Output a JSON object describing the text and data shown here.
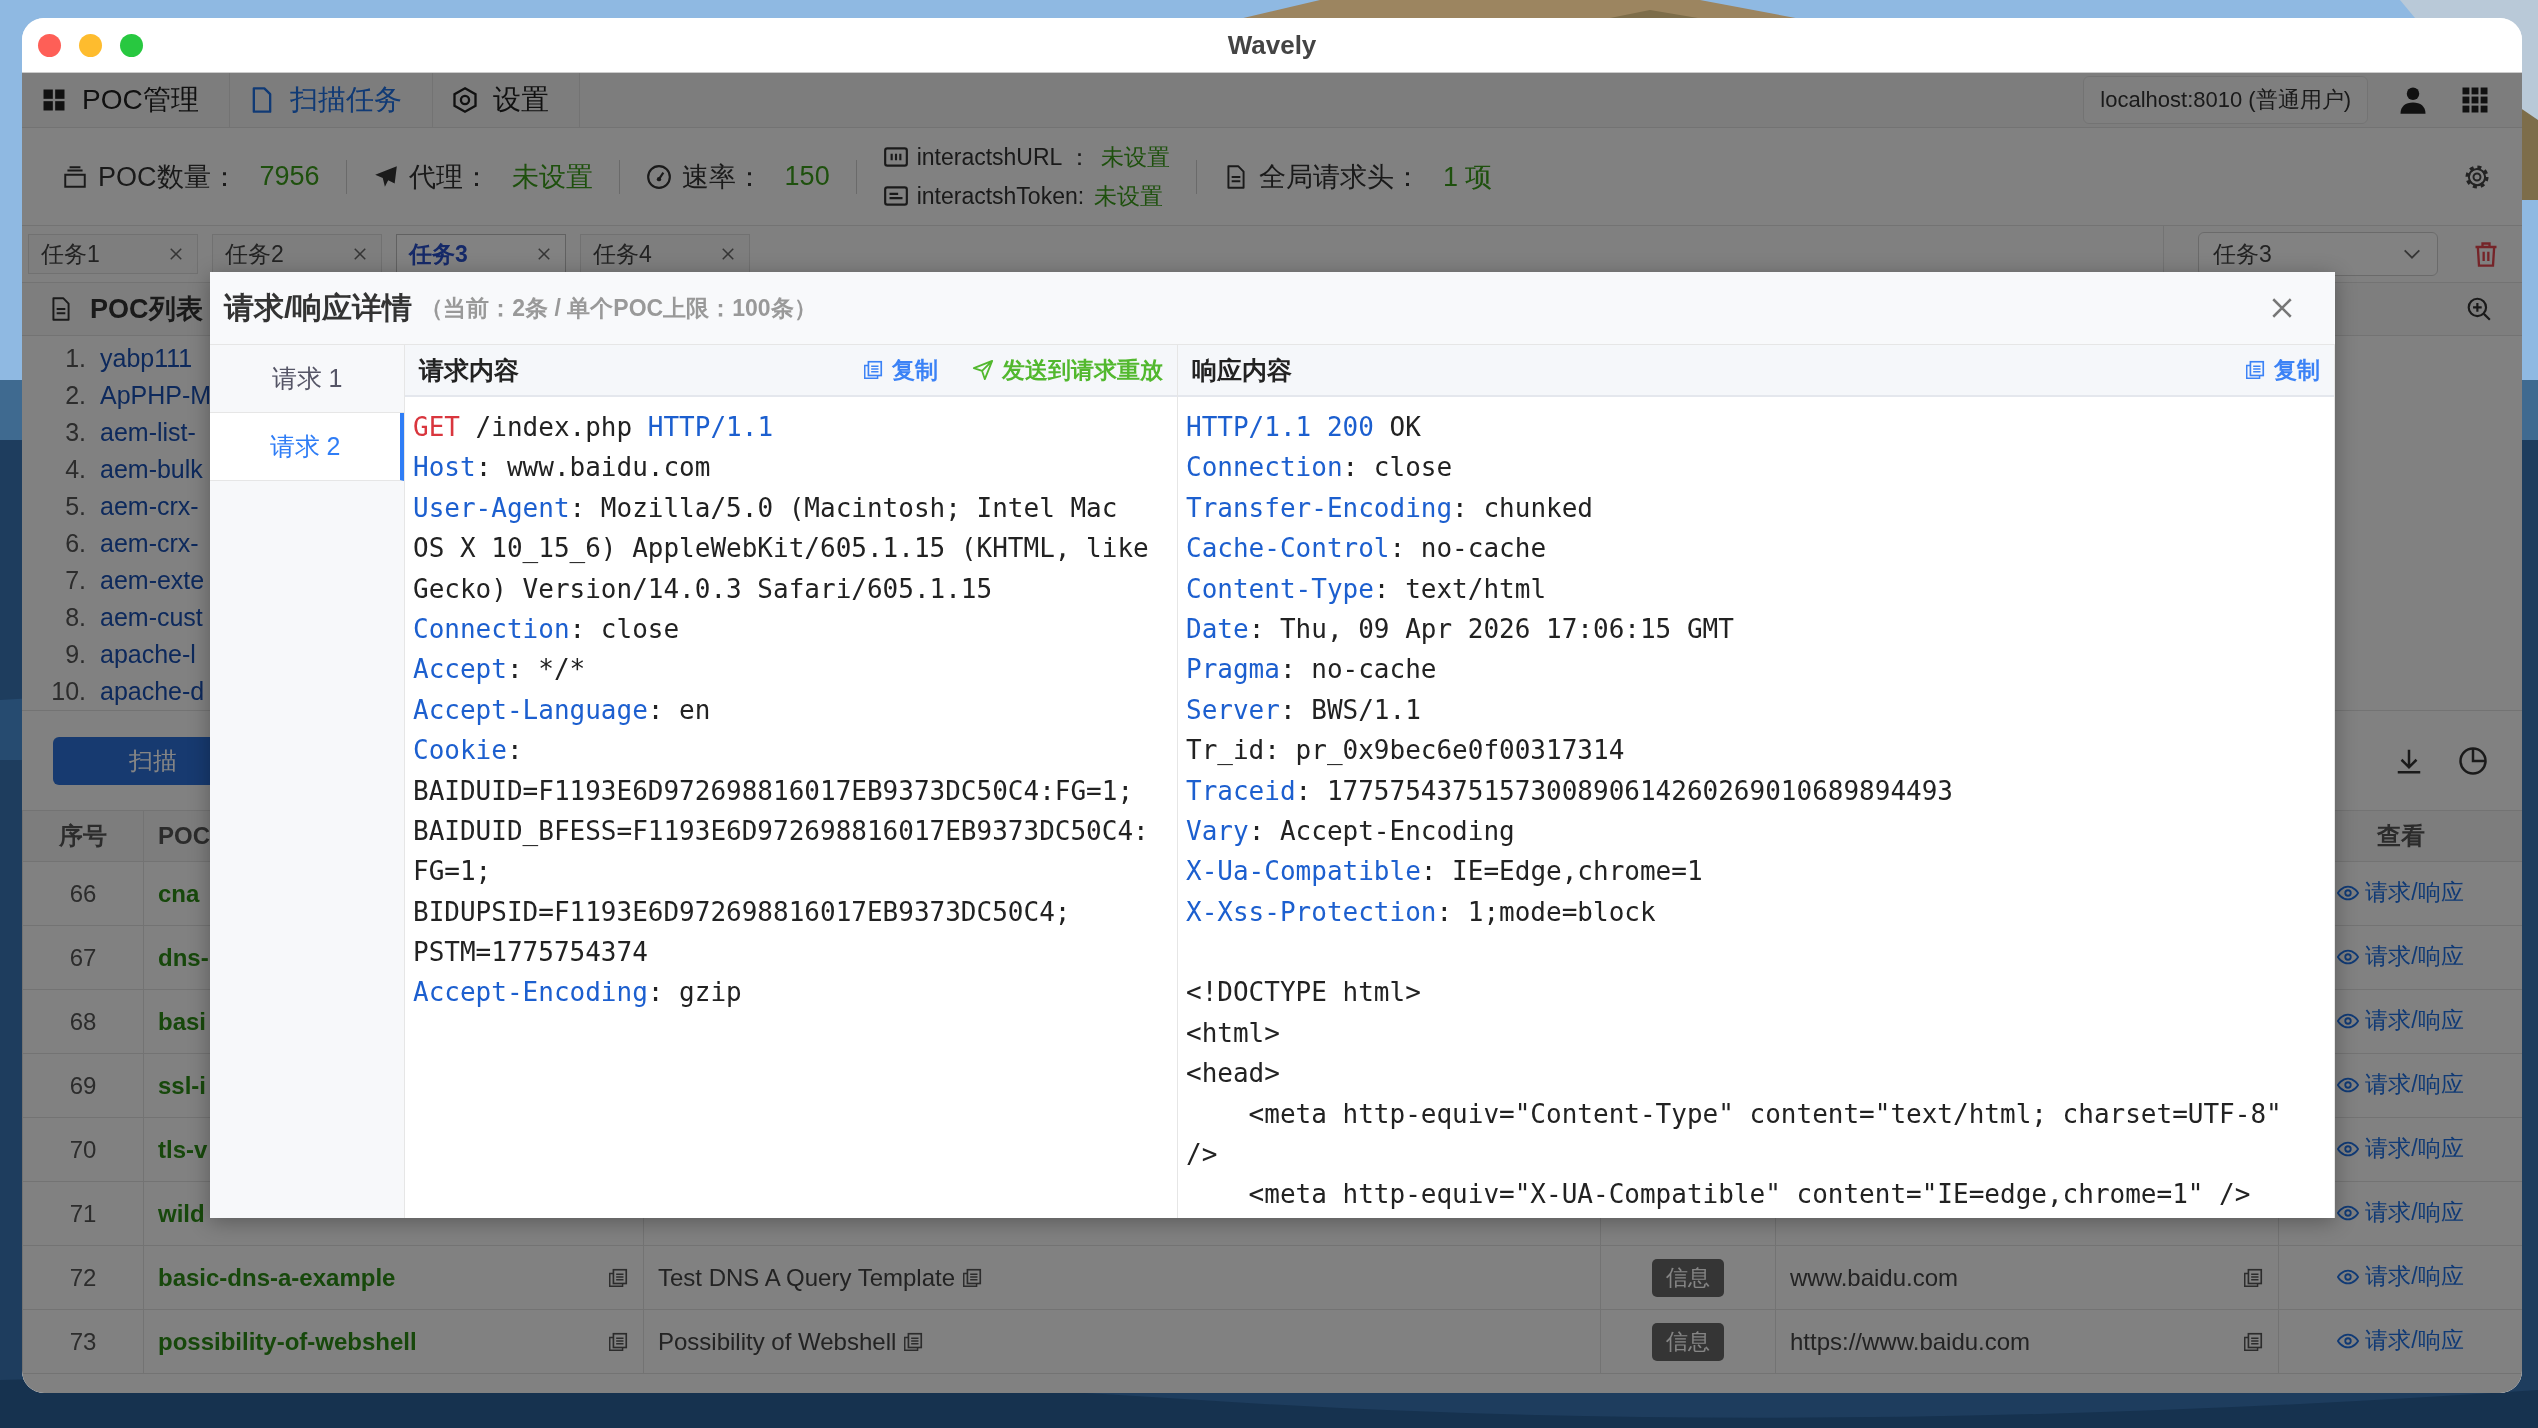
{
  "window": {
    "title": "Wavely"
  },
  "nav": {
    "tabs": [
      {
        "label": "POC管理",
        "selected": false
      },
      {
        "label": "扫描任务",
        "selected": true
      },
      {
        "label": "设置",
        "selected": false
      }
    ],
    "server": "localhost:8010 (普通用户)"
  },
  "stats": [
    {
      "kind": "single",
      "label": "POC数量：",
      "value": "7956"
    },
    {
      "kind": "single",
      "label": "代理：",
      "value": "未设置"
    },
    {
      "kind": "single",
      "label": "速率：",
      "value": "150"
    },
    {
      "kind": "double",
      "items": [
        {
          "label": "interactshURL ：",
          "value": "未设置"
        },
        {
          "label": "interactshToken:",
          "value": "未设置"
        }
      ]
    },
    {
      "kind": "single",
      "label": "全局请求头：",
      "value": "1 项"
    }
  ],
  "task_tabs": [
    {
      "label": "任务1",
      "selected": false
    },
    {
      "label": "任务2",
      "selected": false
    },
    {
      "label": "任务3",
      "selected": true
    },
    {
      "label": "任务4",
      "selected": false
    }
  ],
  "task_select": {
    "value": "任务3"
  },
  "poc_list": {
    "title": "POC列表",
    "items": [
      {
        "number": "1.",
        "name": "yabp111"
      },
      {
        "number": "2.",
        "name": "ApPHP-M"
      },
      {
        "number": "3.",
        "name": "aem-list-"
      },
      {
        "number": "4.",
        "name": "aem-bulk"
      },
      {
        "number": "5.",
        "name": "aem-crx-"
      },
      {
        "number": "6.",
        "name": "aem-crx-"
      },
      {
        "number": "7.",
        "name": "aem-exte"
      },
      {
        "number": "8.",
        "name": "aem-cust"
      },
      {
        "number": "9.",
        "name": "apache-l"
      },
      {
        "number": "10.",
        "name": "apache-d"
      }
    ]
  },
  "scan_button": "扫描",
  "table": {
    "header": {
      "index": "序号",
      "name": "POC",
      "view": "查看"
    },
    "rows": [
      {
        "index": "66",
        "name": "cna",
        "view": "请求/响应"
      },
      {
        "index": "67",
        "name": "dns-",
        "view": "请求/响应"
      },
      {
        "index": "68",
        "name": "basi",
        "view": "请求/响应"
      },
      {
        "index": "69",
        "name": "ssl-i",
        "view": "请求/响应"
      },
      {
        "index": "70",
        "name": "tls-v",
        "view": "请求/响应"
      },
      {
        "index": "71",
        "name": "wild",
        "view": "请求/响应"
      },
      {
        "index": "72",
        "name": "basic-dns-a-example",
        "description": "Test DNS A Query Template",
        "severity": "信息",
        "target": "www.baidu.com",
        "view": "请求/响应"
      },
      {
        "index": "73",
        "name": "possibility-of-webshell",
        "description": "Possibility of Webshell",
        "severity": "信息",
        "target": "https://www.baidu.com",
        "view": "请求/响应"
      }
    ]
  },
  "modal": {
    "title": "请求/响应详情",
    "subtitle": "（当前：2条 / 单个POC上限：100条）",
    "requests": [
      {
        "label": "请求 1",
        "selected": false
      },
      {
        "label": "请求 2",
        "selected": true
      }
    ],
    "request_panel": {
      "title": "请求内容",
      "actions": [
        {
          "kind": "copy",
          "label": "复制"
        },
        {
          "kind": "send",
          "label": "发送到请求重放"
        }
      ],
      "lines": [
        {
          "segments": [
            {
              "kind": "method",
              "text": "GET"
            },
            {
              "kind": "plain",
              "text": " /index.php "
            },
            {
              "kind": "key",
              "text": "HTTP/1.1"
            }
          ]
        },
        {
          "segments": [
            {
              "kind": "key",
              "text": "Host"
            },
            {
              "kind": "plain",
              "text": ": www.baidu.com"
            }
          ]
        },
        {
          "segments": [
            {
              "kind": "key",
              "text": "User-Agent"
            },
            {
              "kind": "plain",
              "text": ": Mozilla/5.0 (Macintosh; Intel Mac"
            }
          ]
        },
        {
          "segments": [
            {
              "kind": "plain",
              "text": "OS X 10_15_6) AppleWebKit/605.1.15 (KHTML, like"
            }
          ]
        },
        {
          "segments": [
            {
              "kind": "plain",
              "text": "Gecko) Version/14.0.3 Safari/605.1.15"
            }
          ]
        },
        {
          "segments": [
            {
              "kind": "key",
              "text": "Connection"
            },
            {
              "kind": "plain",
              "text": ": close"
            }
          ]
        },
        {
          "segments": [
            {
              "kind": "key",
              "text": "Accept"
            },
            {
              "kind": "plain",
              "text": ": */*"
            }
          ]
        },
        {
          "segments": [
            {
              "kind": "key",
              "text": "Accept-Language"
            },
            {
              "kind": "plain",
              "text": ": en"
            }
          ]
        },
        {
          "segments": [
            {
              "kind": "key",
              "text": "Cookie"
            },
            {
              "kind": "plain",
              "text": ":"
            }
          ]
        },
        {
          "segments": [
            {
              "kind": "plain",
              "text": "BAIDUID=F1193E6D972698816017EB9373DC50C4:FG=1;"
            }
          ]
        },
        {
          "segments": [
            {
              "kind": "plain",
              "text": "BAIDUID_BFESS=F1193E6D972698816017EB9373DC50C4:"
            }
          ]
        },
        {
          "segments": [
            {
              "kind": "plain",
              "text": "FG=1;"
            }
          ]
        },
        {
          "segments": [
            {
              "kind": "plain",
              "text": "BIDUPSID=F1193E6D972698816017EB9373DC50C4;"
            }
          ]
        },
        {
          "segments": [
            {
              "kind": "plain",
              "text": "PSTM=1775754374"
            }
          ]
        },
        {
          "segments": [
            {
              "kind": "key",
              "text": "Accept-Encoding"
            },
            {
              "kind": "plain",
              "text": ": gzip"
            }
          ]
        }
      ]
    },
    "response_panel": {
      "title": "响应内容",
      "actions": [
        {
          "kind": "copy",
          "label": "复制"
        }
      ],
      "lines": [
        {
          "segments": [
            {
              "kind": "key",
              "text": "HTTP/1.1 200"
            },
            {
              "kind": "plain",
              "text": " OK"
            }
          ]
        },
        {
          "segments": [
            {
              "kind": "key",
              "text": "Connection"
            },
            {
              "kind": "plain",
              "text": ": close"
            }
          ]
        },
        {
          "segments": [
            {
              "kind": "key",
              "text": "Transfer-Encoding"
            },
            {
              "kind": "plain",
              "text": ": chunked"
            }
          ]
        },
        {
          "segments": [
            {
              "kind": "key",
              "text": "Cache-Control"
            },
            {
              "kind": "plain",
              "text": ": no-cache"
            }
          ]
        },
        {
          "segments": [
            {
              "kind": "key",
              "text": "Content-Type"
            },
            {
              "kind": "plain",
              "text": ": text/html"
            }
          ]
        },
        {
          "segments": [
            {
              "kind": "key",
              "text": "Date"
            },
            {
              "kind": "plain",
              "text": ": Thu, 09 Apr 2026 17:06:15 GMT"
            }
          ]
        },
        {
          "segments": [
            {
              "kind": "key",
              "text": "Pragma"
            },
            {
              "kind": "plain",
              "text": ": no-cache"
            }
          ]
        },
        {
          "segments": [
            {
              "kind": "key",
              "text": "Server"
            },
            {
              "kind": "plain",
              "text": ": BWS/1.1"
            }
          ]
        },
        {
          "segments": [
            {
              "kind": "plain",
              "text": "Tr_id: pr_0x9bec6e0f00317314"
            }
          ]
        },
        {
          "segments": [
            {
              "kind": "key",
              "text": "Traceid"
            },
            {
              "kind": "plain",
              "text": ": 1775754375157300890614260269010689894493"
            }
          ]
        },
        {
          "segments": [
            {
              "kind": "key",
              "text": "Vary"
            },
            {
              "kind": "plain",
              "text": ": Accept-Encoding"
            }
          ]
        },
        {
          "segments": [
            {
              "kind": "key",
              "text": "X-Ua-Compatible"
            },
            {
              "kind": "plain",
              "text": ": IE=Edge,chrome=1"
            }
          ]
        },
        {
          "segments": [
            {
              "kind": "key",
              "text": "X-Xss-Protection"
            },
            {
              "kind": "plain",
              "text": ": 1;mode=block"
            }
          ]
        },
        {
          "kind": "blank"
        },
        {
          "segments": [
            {
              "kind": "plain",
              "text": "<!DOCTYPE html>"
            }
          ]
        },
        {
          "segments": [
            {
              "kind": "plain",
              "text": "<html>"
            }
          ]
        },
        {
          "segments": [
            {
              "kind": "plain",
              "text": "<head>"
            }
          ]
        },
        {
          "segments": [
            {
              "kind": "plain",
              "text": "    <meta http-equiv=\"Content-Type\" content=\"text/html; charset=UTF-8\""
            }
          ]
        },
        {
          "segments": [
            {
              "kind": "plain",
              "text": "/>"
            }
          ]
        },
        {
          "segments": [
            {
              "kind": "plain",
              "text": "    <meta http-equiv=\"X-UA-Compatible\" content=\"IE=edge,chrome=1\" />"
            }
          ]
        }
      ]
    }
  }
}
